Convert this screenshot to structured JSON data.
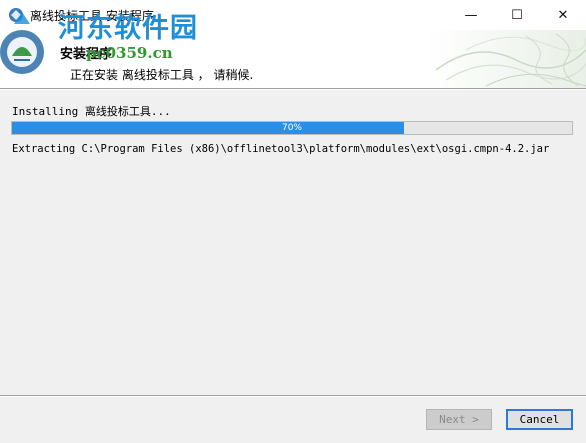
{
  "window": {
    "title": "离线投标工具 安装程序",
    "controls": {
      "minimize": "—",
      "maximize": "☐",
      "close": "✕"
    }
  },
  "header": {
    "title": "安装程序",
    "subtitle": "正在安装 离线投标工具 ， 请稍候."
  },
  "watermark": {
    "site_name": "河东软件园",
    "url": "pc0359.cn"
  },
  "install": {
    "status": "Installing 离线投标工具...",
    "progress_percent": 70,
    "progress_label": "70%",
    "detail": "Extracting C:\\Program Files (x86)\\offlinetool3\\platform\\modules\\ext\\osgi.cmpn-4.2.jar"
  },
  "buttons": {
    "next": "Next >",
    "cancel": "Cancel"
  },
  "colors": {
    "progress_fill": "#2d8ee6",
    "focus_border": "#2d7ad6",
    "watermark_text": "#1d8fd6",
    "watermark_url": "#2e9a2e"
  }
}
